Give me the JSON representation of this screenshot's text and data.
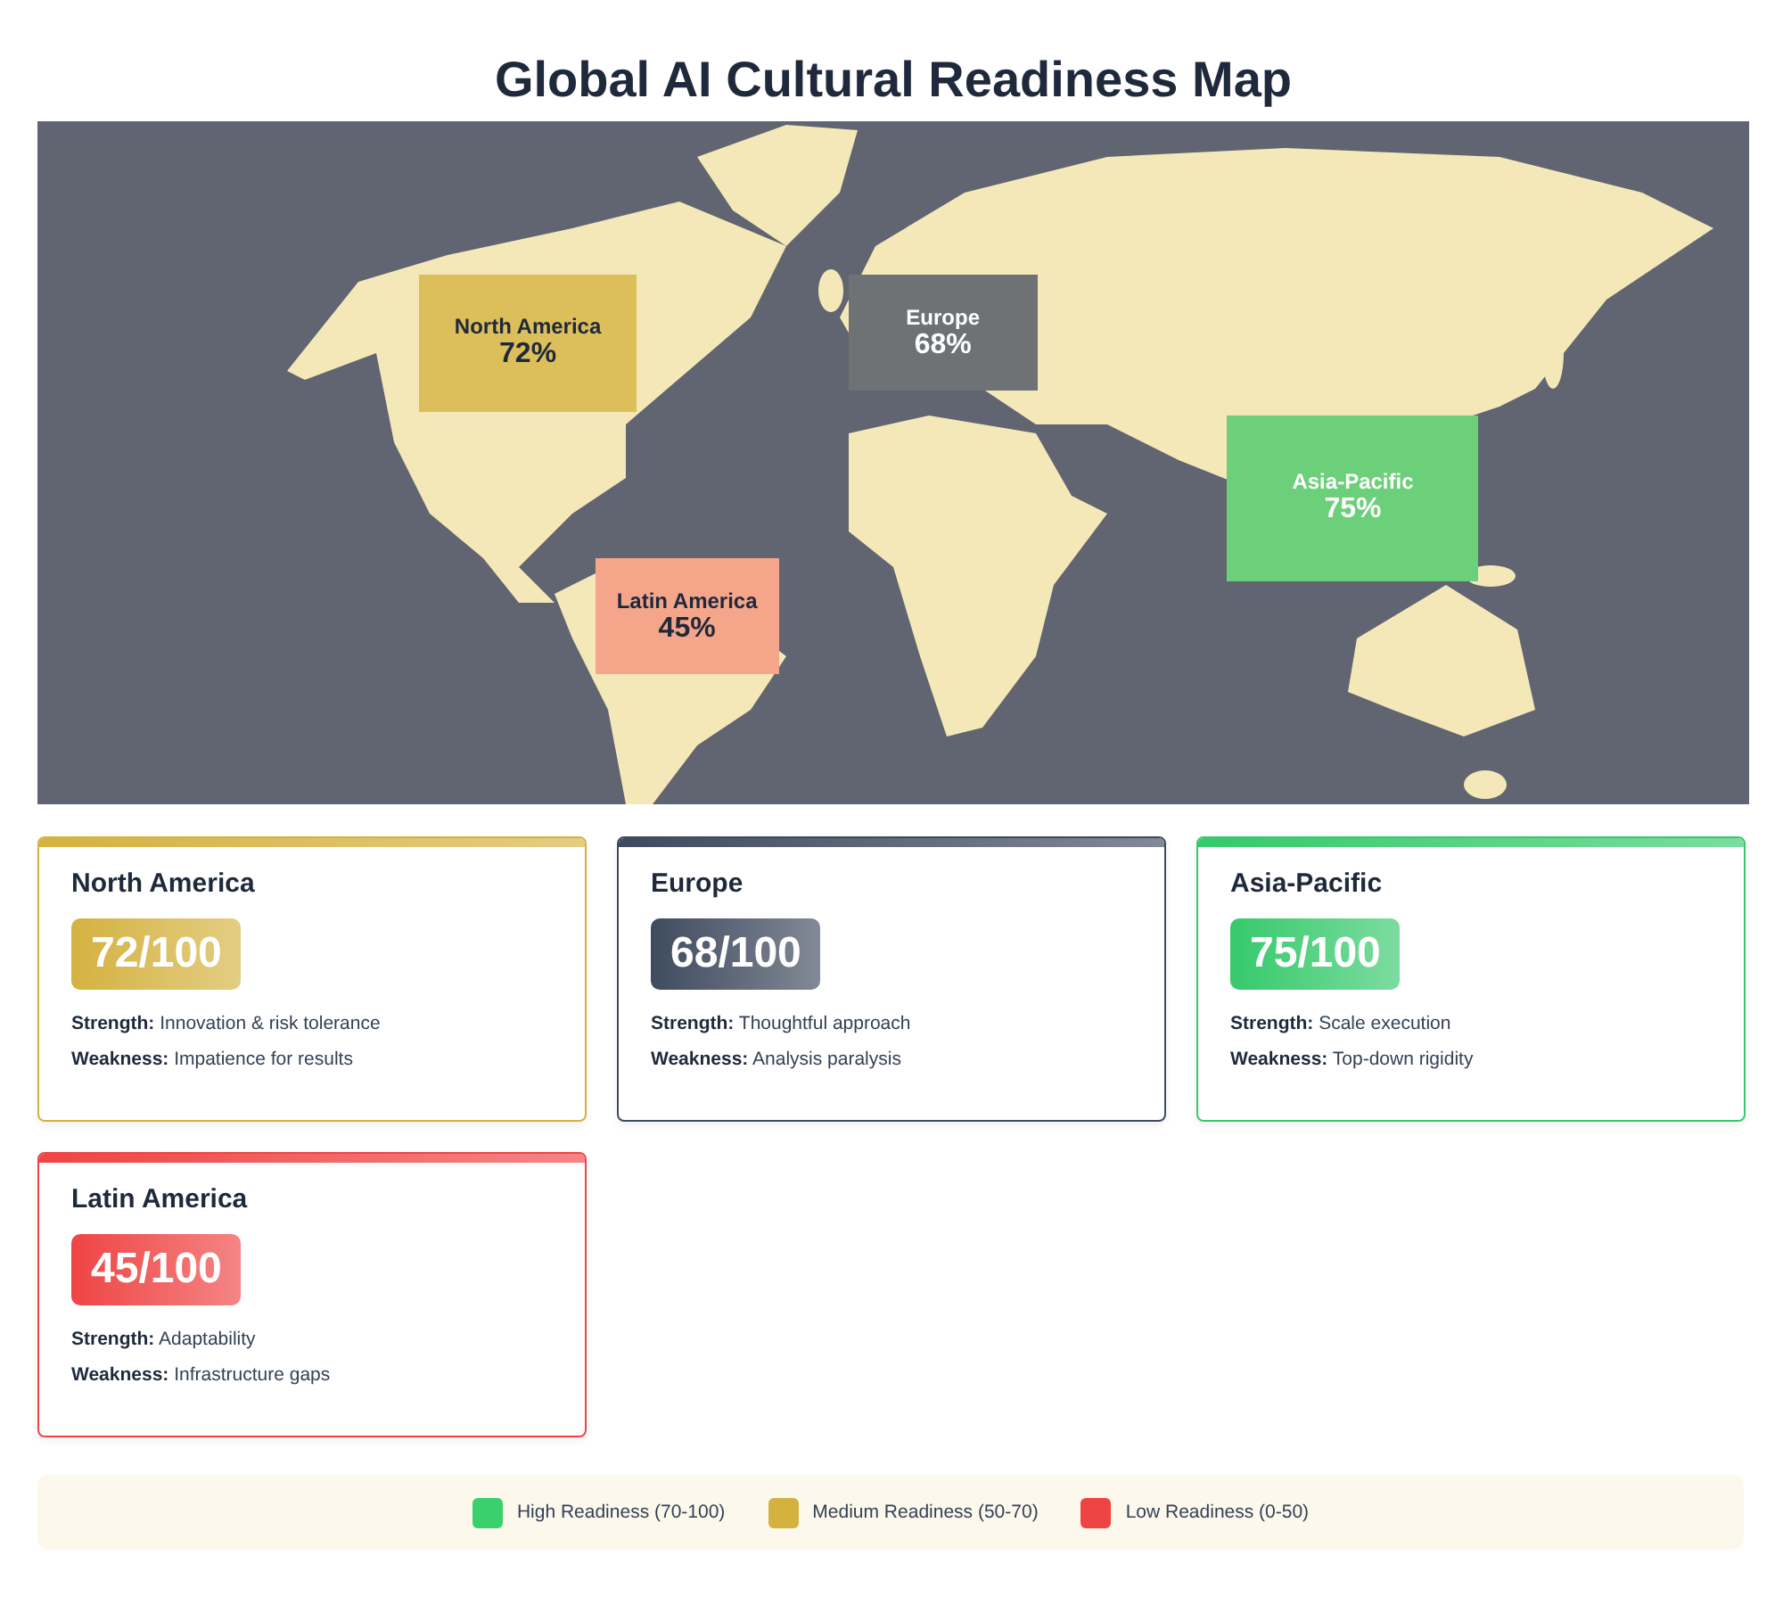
{
  "title": "Global AI Cultural Readiness Map",
  "map": {
    "labels": [
      {
        "region": "North America",
        "percent": "72%",
        "color": "#dcbf5a"
      },
      {
        "region": "Europe",
        "percent": "68%",
        "color": "#6f7275"
      },
      {
        "region": "Asia-Pacific",
        "percent": "75%",
        "color": "#6ccf7a"
      },
      {
        "region": "Latin America",
        "percent": "45%",
        "color": "#f4a58a"
      }
    ]
  },
  "cards": [
    {
      "region": "North America",
      "score": "72/100",
      "color": "#d4b240",
      "strength_label": "Strength:",
      "strength": "Innovation & risk tolerance",
      "weakness_label": "Weakness:",
      "weakness": "Impatience for results"
    },
    {
      "region": "Europe",
      "score": "68/100",
      "color": "#3e4a5e",
      "strength_label": "Strength:",
      "strength": "Thoughtful approach",
      "weakness_label": "Weakness:",
      "weakness": "Analysis paralysis"
    },
    {
      "region": "Asia-Pacific",
      "score": "75/100",
      "color": "#36c96b",
      "strength_label": "Strength:",
      "strength": "Scale execution",
      "weakness_label": "Weakness:",
      "weakness": "Top-down rigidity"
    },
    {
      "region": "Latin America",
      "score": "45/100",
      "color": "#ef4444",
      "strength_label": "Strength:",
      "strength": "Adaptability",
      "weakness_label": "Weakness:",
      "weakness": "Infrastructure gaps"
    }
  ],
  "legend": [
    {
      "label": "High Readiness (70-100)",
      "color": "#3ccf6e"
    },
    {
      "label": "Medium Readiness (50-70)",
      "color": "#d4b240"
    },
    {
      "label": "Low Readiness (0-50)",
      "color": "#ef4444"
    }
  ]
}
